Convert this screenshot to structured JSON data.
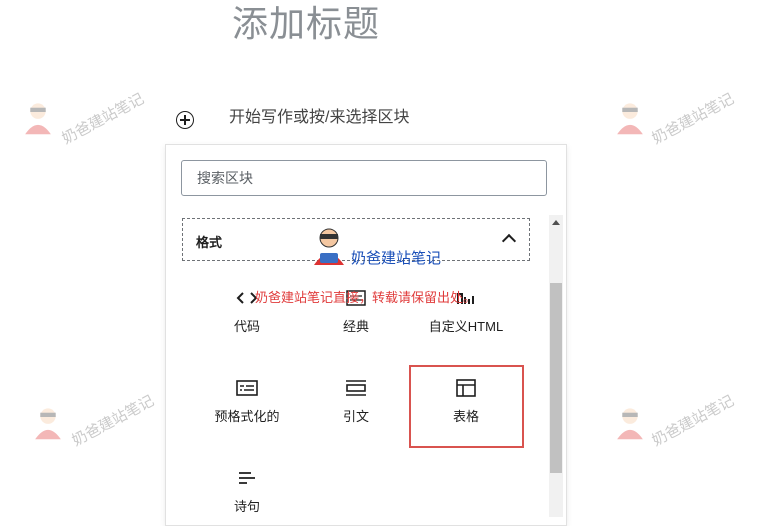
{
  "editor": {
    "title_placeholder": "添加标题",
    "block_prompt": "开始写作或按/来选择区块"
  },
  "inserter": {
    "search_placeholder": "搜索区块",
    "category": {
      "label": "格式"
    },
    "blocks": [
      {
        "label": "代码",
        "icon": "code-icon"
      },
      {
        "label": "经典",
        "icon": "classic-icon"
      },
      {
        "label": "自定义HTML",
        "icon": "html-icon"
      },
      {
        "label": "预格式化的",
        "icon": "preformatted-icon"
      },
      {
        "label": "引文",
        "icon": "pullquote-icon"
      },
      {
        "label": "表格",
        "icon": "table-icon",
        "highlighted": true
      },
      {
        "label": "诗句",
        "icon": "verse-icon"
      }
    ],
    "highlight_color": "#d9534f"
  },
  "watermark": {
    "site": "奶爸建站笔记",
    "notice": "奶爸建站笔记直接，转载请保留出处。"
  }
}
